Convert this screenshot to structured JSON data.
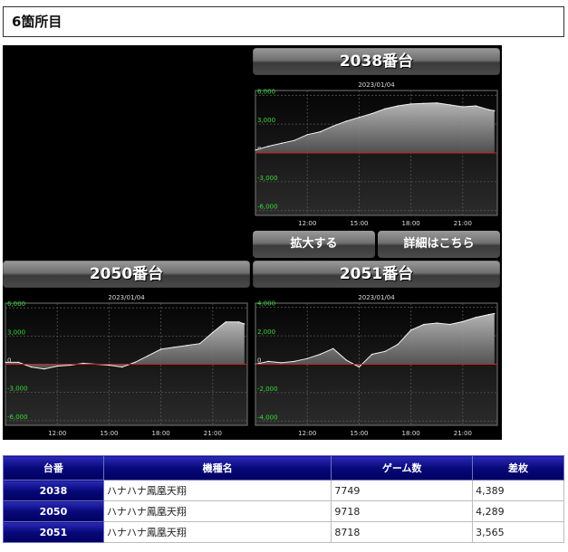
{
  "section_title": "6箇所目",
  "graphs": {
    "g2038": {
      "title": "2038番台",
      "date": "2023/01/04",
      "y_ticks": [
        "6,000",
        "3,000",
        "0",
        "-3,000",
        "-6,000"
      ],
      "x_ticks": [
        "12:00",
        "15:00",
        "18:00",
        "21:00"
      ]
    },
    "g2050": {
      "title": "2050番台",
      "date": "2023/01/04",
      "y_ticks": [
        "6,000",
        "3,000",
        "0",
        "-3,000",
        "-6,000"
      ],
      "x_ticks": [
        "12:00",
        "15:00",
        "18:00",
        "21:00"
      ]
    },
    "g2051": {
      "title": "2051番台",
      "date": "2023/01/04",
      "y_ticks": [
        "4,000",
        "2,000",
        "0",
        "-2,000",
        "-4,000"
      ],
      "x_ticks": [
        "12:00",
        "15:00",
        "18:00",
        "21:00"
      ]
    }
  },
  "buttons": {
    "zoom": "拡大する",
    "details": "詳細はこちら"
  },
  "table": {
    "headers": [
      "台番",
      "機種名",
      "ゲーム数",
      "差枚"
    ],
    "rows": [
      [
        "2038",
        "ハナハナ鳳凰天翔",
        "7749",
        "4,389"
      ],
      [
        "2050",
        "ハナハナ鳳凰天翔",
        "9718",
        "4,289"
      ],
      [
        "2051",
        "ハナハナ鳳凰天翔",
        "8718",
        "3,565"
      ]
    ]
  },
  "colors": {
    "pos_tick": "#33dd33",
    "neg_tick": "#33dd33",
    "zero_line": "#d22020",
    "fill": "#8a8a8a"
  },
  "chart_data": [
    {
      "type": "area",
      "x": [
        "09:00",
        "09:45",
        "10:30",
        "11:15",
        "12:00",
        "12:45",
        "13:30",
        "14:15",
        "15:00",
        "15:45",
        "16:30",
        "17:15",
        "18:00",
        "18:45",
        "19:30",
        "20:15",
        "21:00",
        "21:45",
        "22:30",
        "22:50"
      ],
      "values": [
        300,
        700,
        1000,
        1300,
        1900,
        2200,
        2800,
        3300,
        3700,
        4100,
        4600,
        4900,
        5100,
        5150,
        5200,
        5000,
        4800,
        4900,
        4500,
        4389
      ],
      "ylim": [
        -6500,
        6500
      ],
      "grid": true
    },
    {
      "type": "area",
      "x": [
        "09:00",
        "09:45",
        "10:30",
        "11:15",
        "12:00",
        "12:45",
        "13:30",
        "14:15",
        "15:00",
        "15:45",
        "16:30",
        "17:15",
        "18:00",
        "18:45",
        "19:30",
        "20:15",
        "21:00",
        "21:45",
        "22:30",
        "22:50"
      ],
      "values": [
        200,
        200,
        -300,
        -500,
        -200,
        -100,
        100,
        0,
        -100,
        -300,
        200,
        900,
        1600,
        1800,
        2000,
        2200,
        3400,
        4500,
        4500,
        4289
      ],
      "ylim": [
        -6500,
        6500
      ],
      "grid": true
    },
    {
      "type": "area",
      "x": [
        "09:00",
        "09:45",
        "10:30",
        "11:15",
        "12:00",
        "12:45",
        "13:30",
        "14:15",
        "15:00",
        "15:45",
        "16:30",
        "17:15",
        "18:00",
        "18:45",
        "19:30",
        "20:15",
        "21:00",
        "21:45",
        "22:30",
        "22:50"
      ],
      "values": [
        0,
        200,
        100,
        200,
        400,
        700,
        1100,
        300,
        -200,
        700,
        900,
        1400,
        2400,
        2800,
        2900,
        2800,
        3000,
        3300,
        3500,
        3565
      ],
      "ylim": [
        -4300,
        4300
      ],
      "grid": true
    }
  ]
}
